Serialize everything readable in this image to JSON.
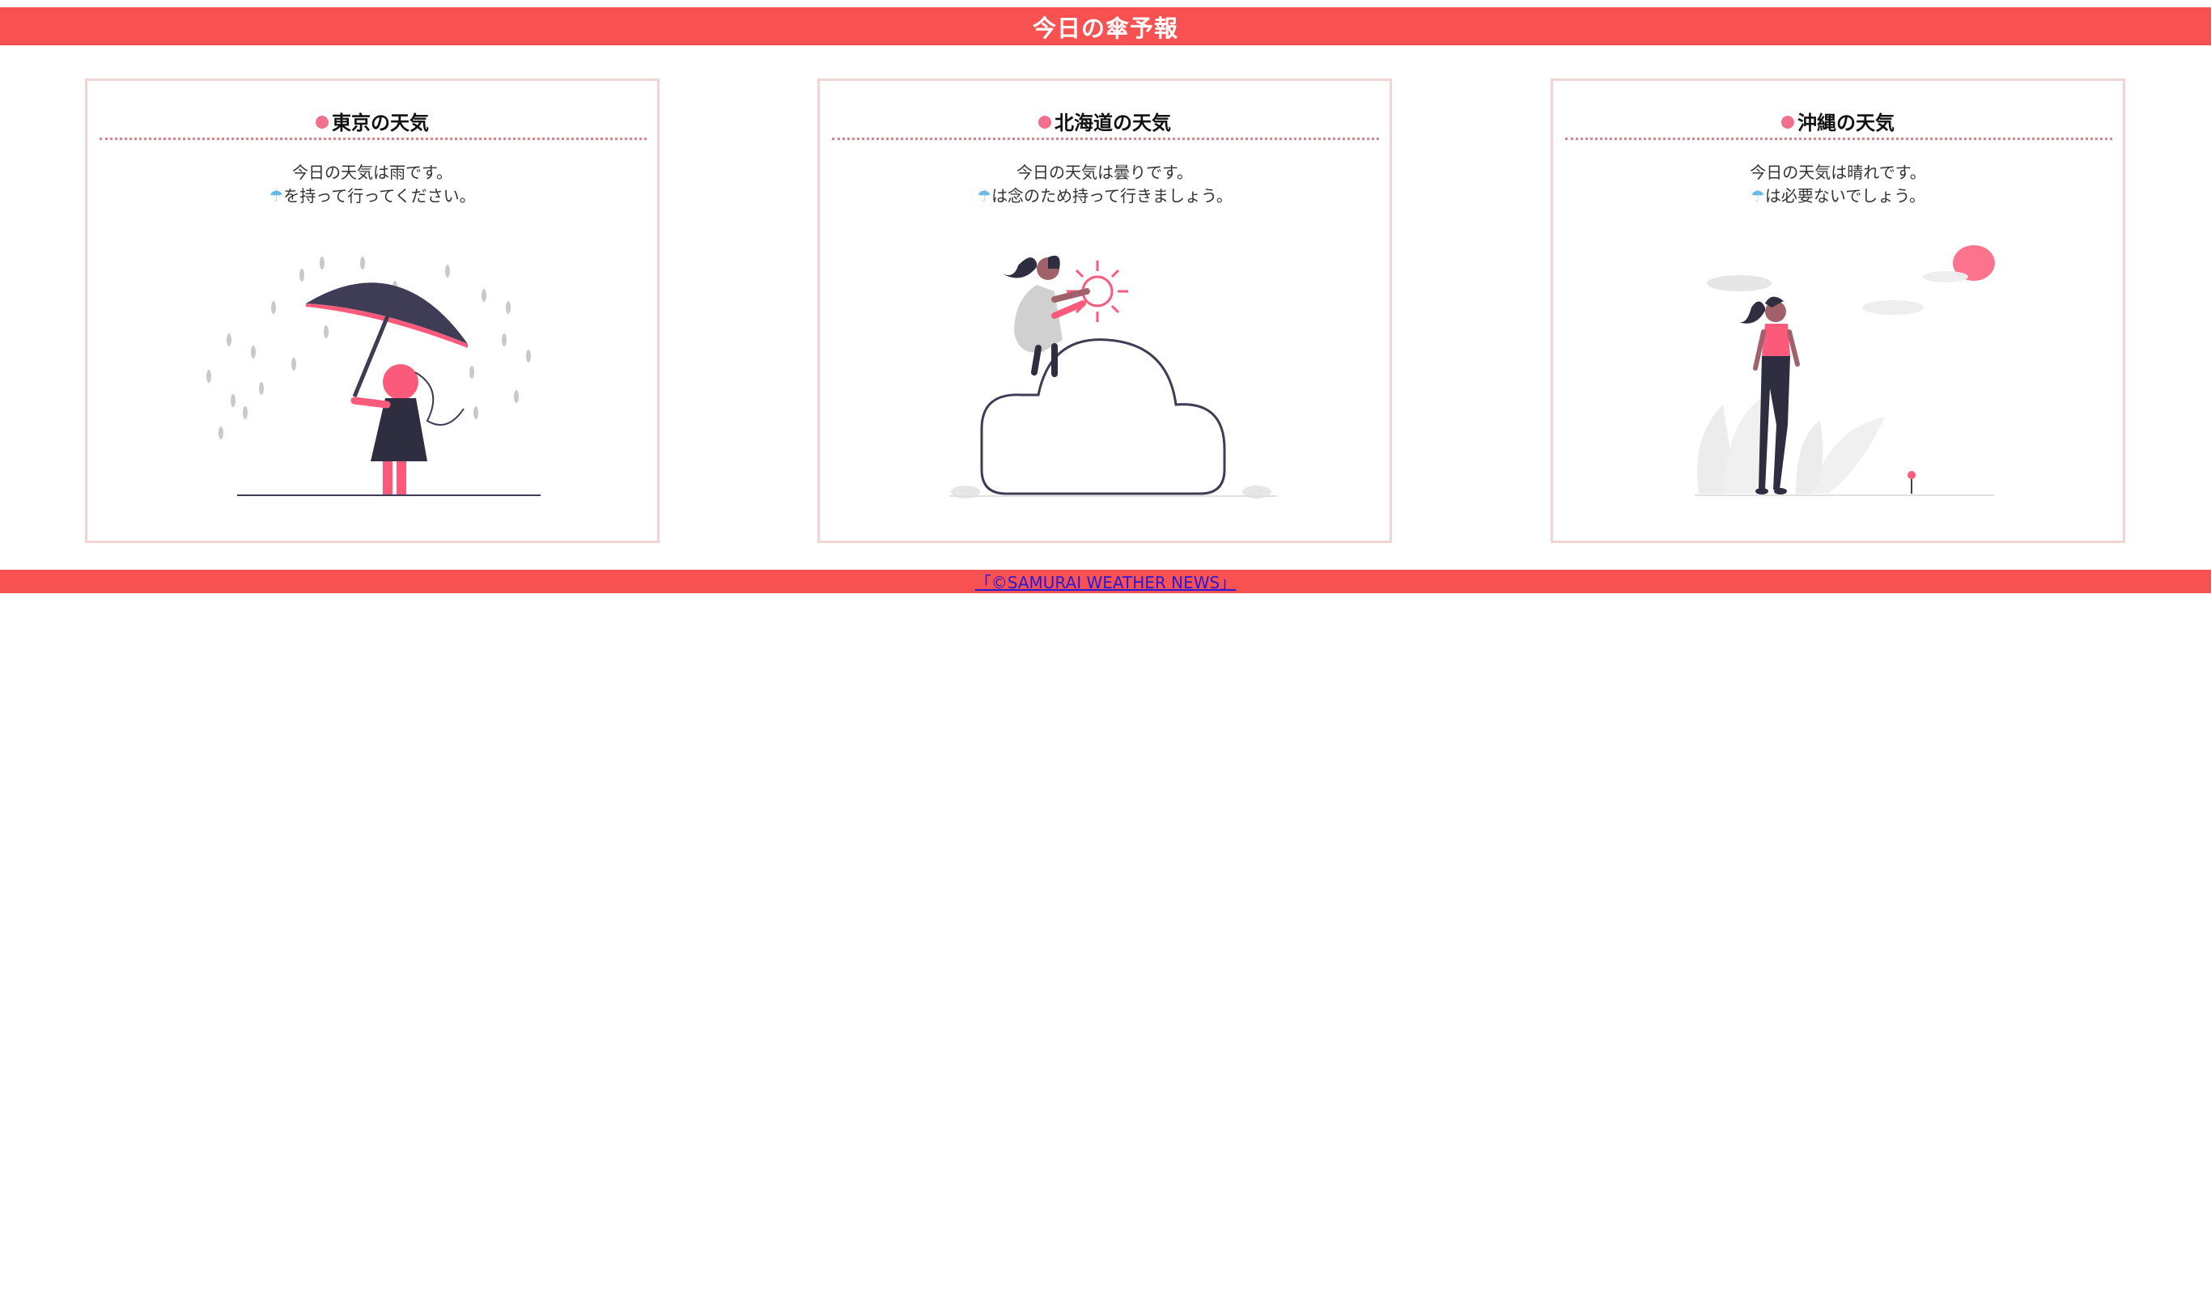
{
  "header": {
    "title": "今日の傘予報"
  },
  "cards": [
    {
      "title": "東京の天気",
      "line1": "今日の天気は雨です。",
      "umbrella_glyph": "☂",
      "line2": "を持って行ってください。",
      "illustration": "rain-umbrella-illustration"
    },
    {
      "title": "北海道の天気",
      "line1": "今日の天気は曇りです。",
      "umbrella_glyph": "☂",
      "line2": "は念のため持って行きましょう。",
      "illustration": "cloud-sun-illustration"
    },
    {
      "title": "沖縄の天気",
      "line1": "今日の天気は晴れです。",
      "umbrella_glyph": "☂",
      "line2": "は必要ないでしょう。",
      "illustration": "sunny-walk-illustration"
    }
  ],
  "footer": {
    "link_text": "「©SAMURAI WEATHER NEWS」"
  },
  "colors": {
    "accent": "#f75151",
    "card_border": "#f2d4d5",
    "dot": "#f0708e",
    "umbrella_icon": "#66b8e8",
    "figure_pink": "#fb5a7a",
    "figure_dark": "#3f3d56"
  }
}
